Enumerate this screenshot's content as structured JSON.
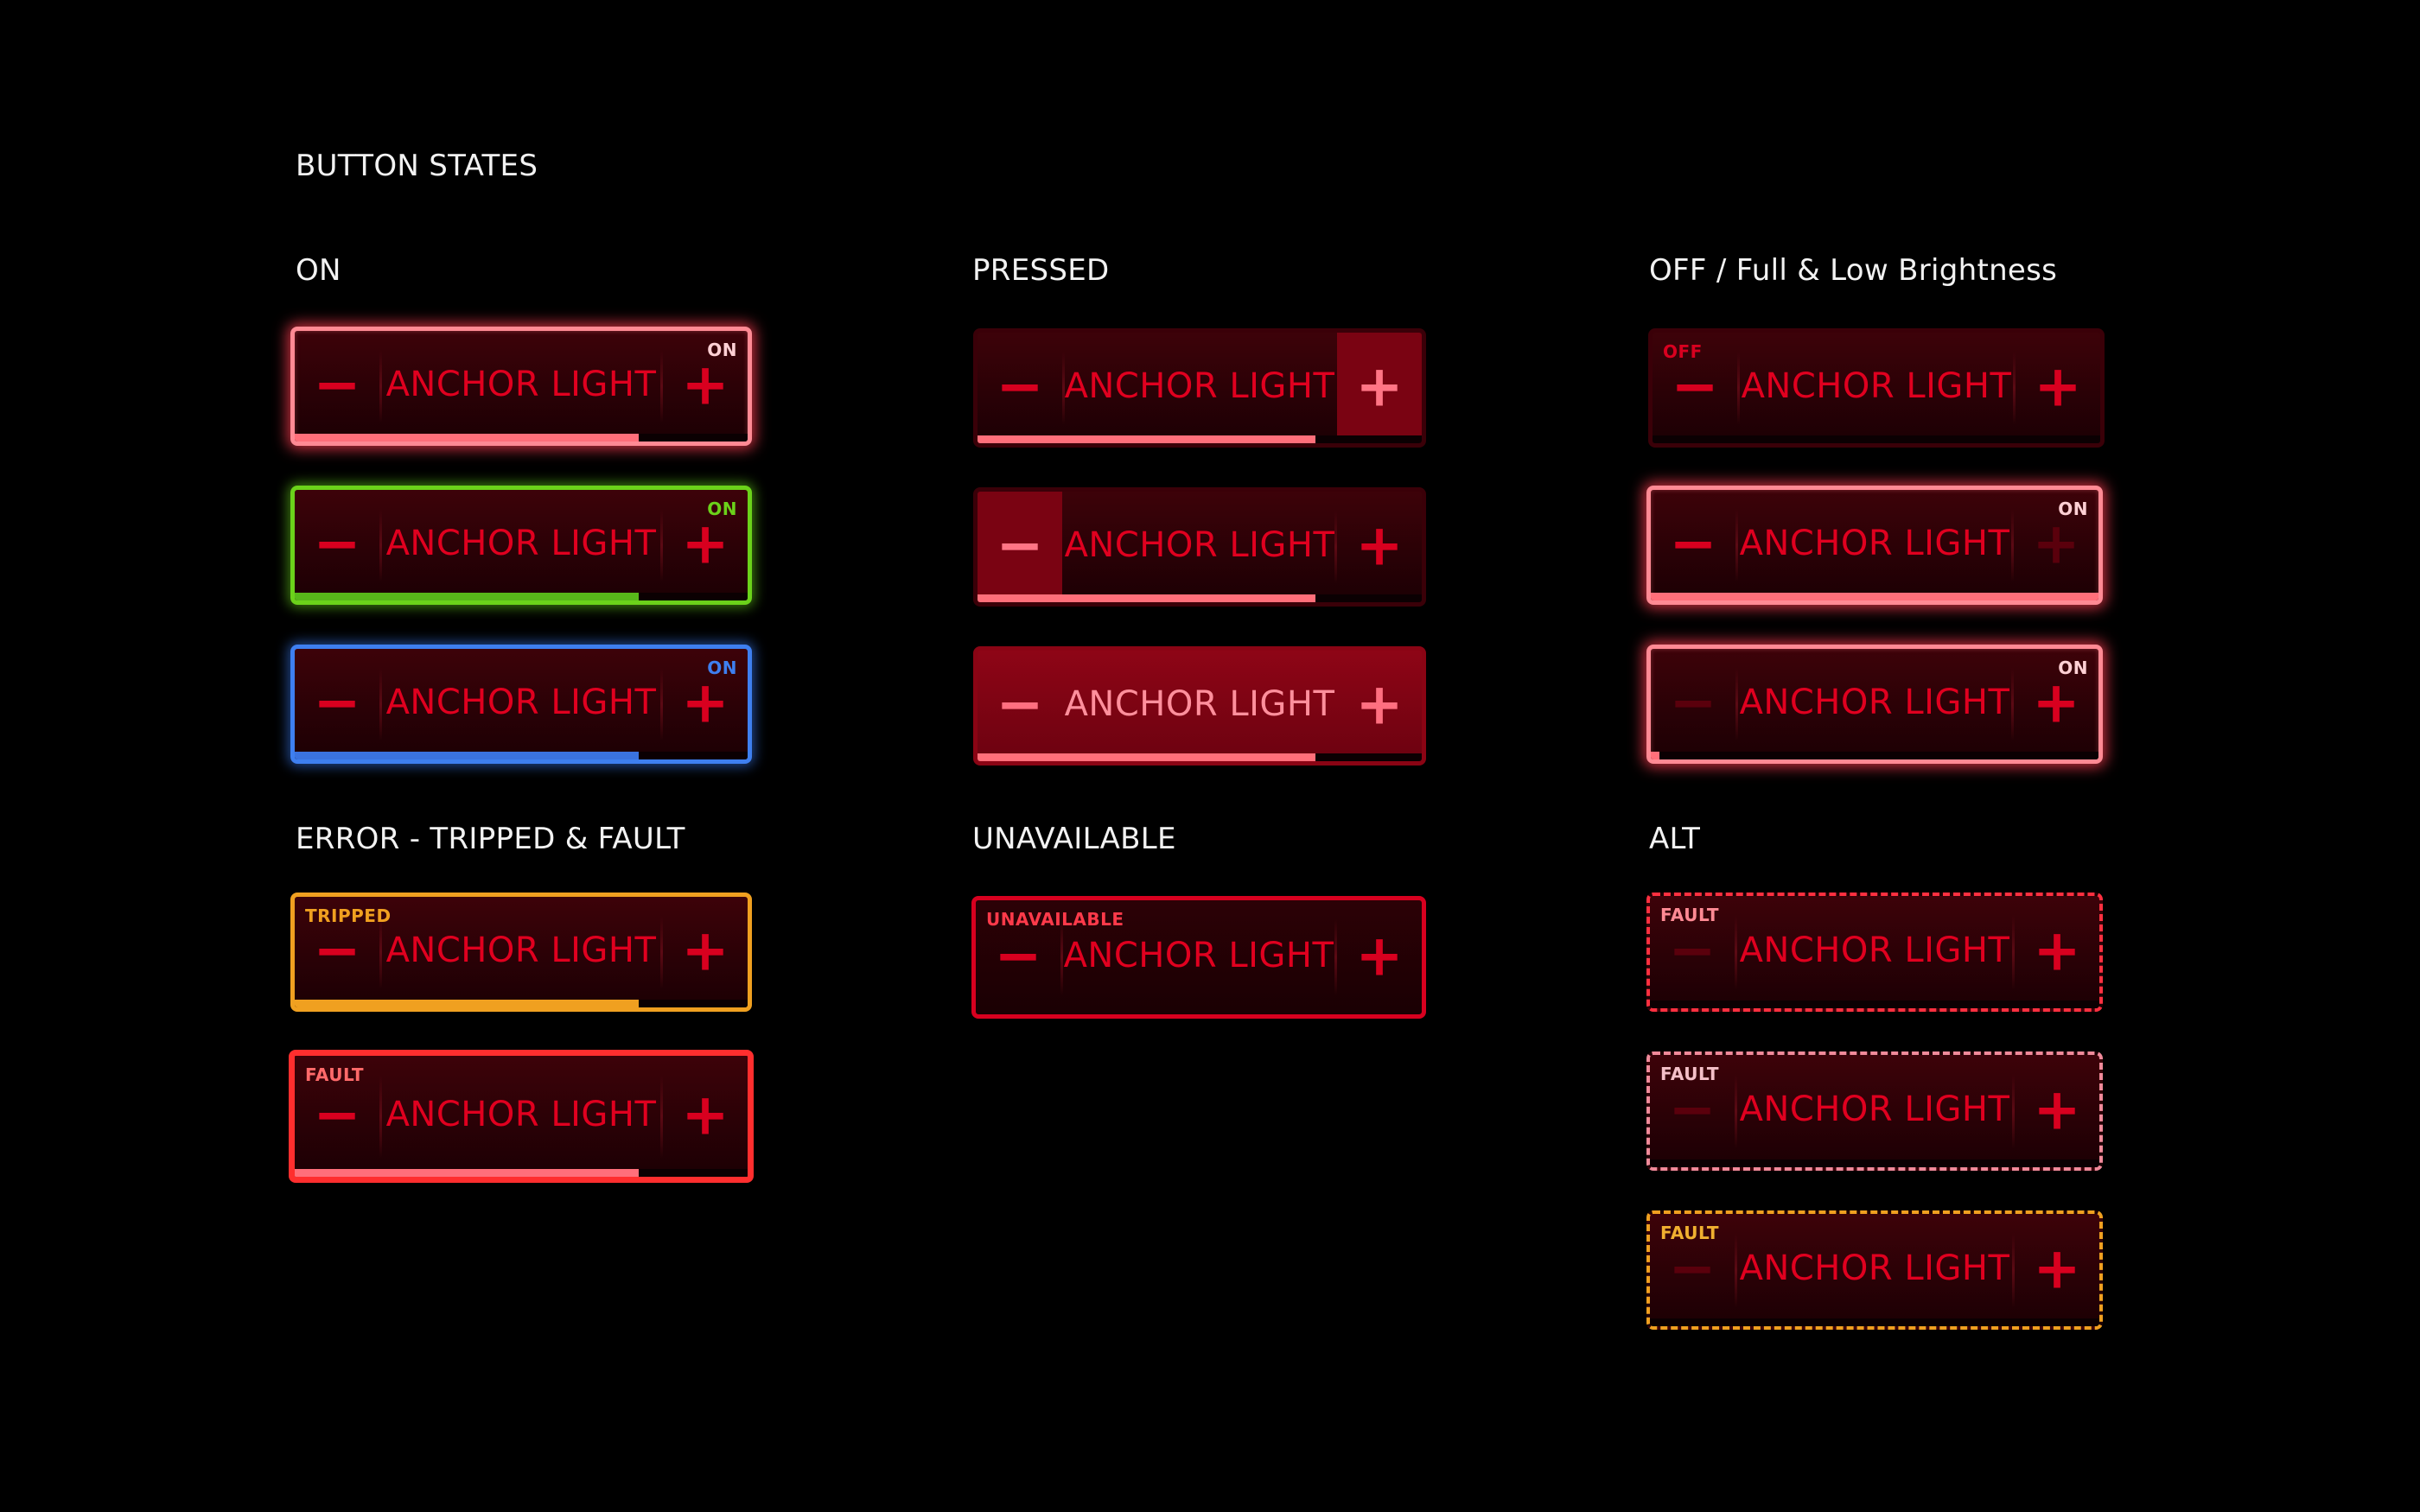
{
  "page": {
    "title": "BUTTON STATES"
  },
  "sections": {
    "on": "ON",
    "pressed": "PRESSED",
    "off": "OFF / Full & Low Brightness",
    "error": "ERROR - TRIPPED & FAULT",
    "unavailable": "UNAVAILABLE",
    "alt": "ALT"
  },
  "button": {
    "label": "ANCHOR LIGHT",
    "minus": "−",
    "plus": "+"
  },
  "badges": {
    "on": "ON",
    "off": "OFF",
    "tripped": "TRIPPED",
    "fault": "FAULT",
    "unavailable": "UNAVAILABLE"
  },
  "levels": {
    "on": 0.76,
    "pressed": 0.76,
    "off": 0.0,
    "full": 1.0,
    "low": 0.02,
    "tripped": 0.76,
    "fault": 0.76
  },
  "colors": {
    "background": "#000000",
    "label": "#e0001f",
    "on_red": "#ff8a94",
    "on_green": "#6bd21a",
    "on_blue": "#3e7ff0",
    "tripped": "#f0a020",
    "fault": "#ff2e2e",
    "unavailable": "#d8001f",
    "fault_pink": "#f08a9a",
    "fill_red": "#ff6f7a",
    "fill_green": "#58b81a",
    "fill_blue": "#3a73e0",
    "fill_orange": "#f0a020"
  }
}
